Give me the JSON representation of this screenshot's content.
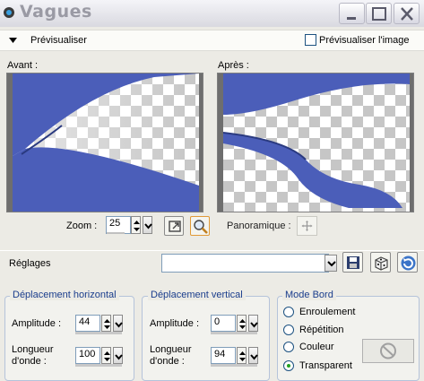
{
  "window": {
    "title": "Vagues"
  },
  "preview_bar": {
    "label": "Prévisualiser",
    "checkbox_label": "Prévisualiser l'image",
    "checkbox_checked": false
  },
  "panes": {
    "before_label": "Avant :",
    "after_label": "Après :"
  },
  "zoom": {
    "label": "Zoom :",
    "value": "25"
  },
  "pan": {
    "label": "Panoramique :"
  },
  "settings": {
    "label": "Réglages",
    "preset_value": ""
  },
  "horizontal": {
    "title": "Déplacement horizontal",
    "amplitude_label": "Amplitude :",
    "amplitude_value": "44",
    "wavelength_label_1": "Longueur",
    "wavelength_label_2": "d'onde :",
    "wavelength_value": "100"
  },
  "vertical": {
    "title": "Déplacement vertical",
    "amplitude_label": "Amplitude :",
    "amplitude_value": "0",
    "wavelength_label_1": "Longueur",
    "wavelength_label_2": "d'onde :",
    "wavelength_value": "94"
  },
  "edge_mode": {
    "title": "Mode Bord",
    "options": [
      "Enroulement",
      "Répétition",
      "Couleur",
      "Transparent"
    ],
    "selected": "Transparent"
  },
  "colors": {
    "shape_blue": "#4b5eb9",
    "group_title": "#1a3d8c",
    "radio_dot": "#21a121"
  }
}
